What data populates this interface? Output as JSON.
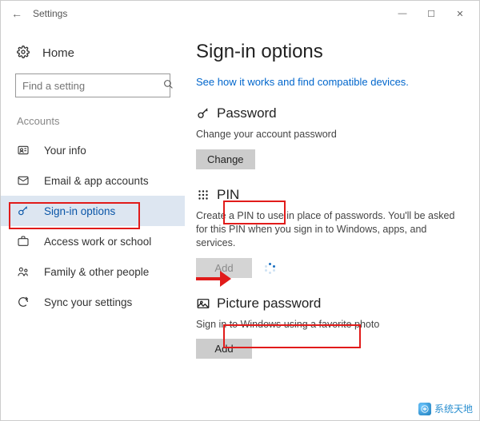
{
  "titlebar": {
    "back_label": "←",
    "app_title": "Settings",
    "min": "—",
    "max": "☐",
    "close": "✕"
  },
  "sidebar": {
    "home_label": "Home",
    "search_placeholder": "Find a setting",
    "section_header": "Accounts",
    "items": [
      {
        "icon": "person",
        "label": "Your info",
        "selected": false
      },
      {
        "icon": "mail",
        "label": "Email & app accounts",
        "selected": false
      },
      {
        "icon": "key",
        "label": "Sign-in options",
        "selected": true
      },
      {
        "icon": "work",
        "label": "Access work or school",
        "selected": false
      },
      {
        "icon": "family",
        "label": "Family & other people",
        "selected": false
      },
      {
        "icon": "sync",
        "label": "Sync your settings",
        "selected": false
      }
    ]
  },
  "main": {
    "title": "Sign-in options",
    "link": "See how it works and find compatible devices.",
    "password": {
      "heading": "Password",
      "desc": "Change your account password",
      "button": "Change"
    },
    "pin": {
      "heading": "PIN",
      "desc": "Create a PIN to use in place of passwords. You'll be asked for this PIN when you sign in to Windows, apps, and services.",
      "button": "Add"
    },
    "picture": {
      "heading": "Picture password",
      "desc": "Sign in to Windows using a favorite photo",
      "button": "Add"
    }
  },
  "watermark": {
    "text": "系统天地"
  },
  "annotations": {
    "red_boxes": [
      "sidebar-sign-in-options",
      "pin-heading",
      "picture-password-heading"
    ],
    "arrow_target": "pin-add-button"
  }
}
